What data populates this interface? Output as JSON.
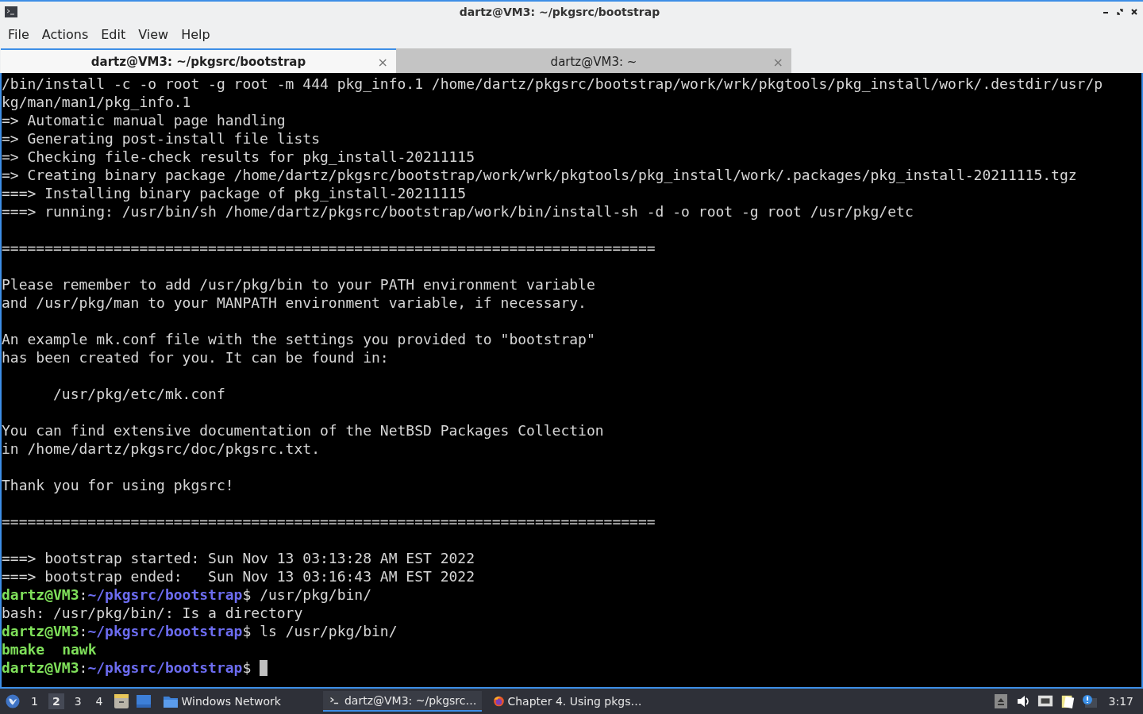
{
  "window": {
    "title": "dartz@VM3: ~/pkgsrc/bootstrap"
  },
  "menu": [
    "File",
    "Actions",
    "Edit",
    "View",
    "Help"
  ],
  "tabs": [
    {
      "label": "dartz@VM3: ~/pkgsrc/bootstrap",
      "selected": true,
      "close": "×"
    },
    {
      "label": "dartz@VM3: ~",
      "selected": false,
      "close": "×"
    }
  ],
  "terminal": {
    "lines": [
      {
        "kind": "text",
        "text": "/bin/install -c -o root -g root -m 444 pkg_info.1 /home/dartz/pkgsrc/bootstrap/work/wrk/pkgtools/pkg_install/work/.destdir/usr/p"
      },
      {
        "kind": "text",
        "text": "kg/man/man1/pkg_info.1"
      },
      {
        "kind": "text",
        "text": "=> Automatic manual page handling"
      },
      {
        "kind": "text",
        "text": "=> Generating post-install file lists"
      },
      {
        "kind": "text",
        "text": "=> Checking file-check results for pkg_install-20211115"
      },
      {
        "kind": "text",
        "text": "=> Creating binary package /home/dartz/pkgsrc/bootstrap/work/wrk/pkgtools/pkg_install/work/.packages/pkg_install-20211115.tgz"
      },
      {
        "kind": "text",
        "text": "===> Installing binary package of pkg_install-20211115"
      },
      {
        "kind": "text",
        "text": "===> running: /usr/bin/sh /home/dartz/pkgsrc/bootstrap/work/bin/install-sh -d -o root -g root /usr/pkg/etc"
      },
      {
        "kind": "blank"
      },
      {
        "kind": "text",
        "text": "============================================================================"
      },
      {
        "kind": "blank"
      },
      {
        "kind": "text",
        "text": "Please remember to add /usr/pkg/bin to your PATH environment variable"
      },
      {
        "kind": "text",
        "text": "and /usr/pkg/man to your MANPATH environment variable, if necessary."
      },
      {
        "kind": "blank"
      },
      {
        "kind": "text",
        "text": "An example mk.conf file with the settings you provided to \"bootstrap\""
      },
      {
        "kind": "text",
        "text": "has been created for you. It can be found in:"
      },
      {
        "kind": "blank"
      },
      {
        "kind": "text",
        "text": "      /usr/pkg/etc/mk.conf"
      },
      {
        "kind": "blank"
      },
      {
        "kind": "text",
        "text": "You can find extensive documentation of the NetBSD Packages Collection"
      },
      {
        "kind": "text",
        "text": "in /home/dartz/pkgsrc/doc/pkgsrc.txt."
      },
      {
        "kind": "blank"
      },
      {
        "kind": "text",
        "text": "Thank you for using pkgsrc!"
      },
      {
        "kind": "blank"
      },
      {
        "kind": "text",
        "text": "============================================================================"
      },
      {
        "kind": "blank"
      },
      {
        "kind": "text",
        "text": "===> bootstrap started: Sun Nov 13 03:13:28 AM EST 2022"
      },
      {
        "kind": "text",
        "text": "===> bootstrap ended:   Sun Nov 13 03:16:43 AM EST 2022"
      },
      {
        "kind": "prompt",
        "user": "dartz@VM3",
        "colon": ":",
        "path": "~/pkgsrc/bootstrap",
        "command": "$ /usr/pkg/bin/"
      },
      {
        "kind": "text",
        "text": "bash: /usr/pkg/bin/: Is a directory"
      },
      {
        "kind": "prompt",
        "user": "dartz@VM3",
        "colon": ":",
        "path": "~/pkgsrc/bootstrap",
        "command": "$ ls /usr/pkg/bin/"
      },
      {
        "kind": "listing",
        "entries": [
          "bmake",
          "nawk"
        ]
      },
      {
        "kind": "prompt",
        "user": "dartz@VM3",
        "colon": ":",
        "path": "~/pkgsrc/bootstrap",
        "command": "$ ",
        "cursor": true
      }
    ]
  },
  "taskbar": {
    "desktops": [
      {
        "label": "1",
        "selected": false
      },
      {
        "label": "2",
        "selected": true
      },
      {
        "label": "3",
        "selected": false
      },
      {
        "label": "4",
        "selected": false
      }
    ],
    "tasks": [
      {
        "kind": "folder",
        "label": "Windows Network",
        "selected": false
      },
      {
        "kind": "terminal",
        "label": "dartz@VM3: ~/pkgsrc…",
        "selected": true
      },
      {
        "kind": "browser",
        "label": "Chapter 4. Using pkgs…",
        "selected": false
      }
    ],
    "clock": "3:17"
  }
}
